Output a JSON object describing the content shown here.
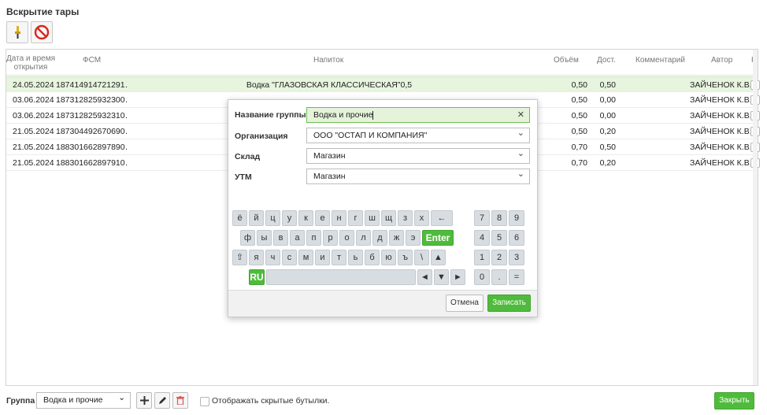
{
  "window": {
    "title": "Вскрытие тары"
  },
  "toolbar": {
    "open_icon": "bottle-opener-icon",
    "cancel_icon": "no-entry-icon"
  },
  "table": {
    "headers": {
      "date_line1": "Дата и время",
      "date_line2": "открытия",
      "fsm": "ФСМ",
      "drink": "Напиток",
      "volume": "Объём",
      "remaining": "Дост.",
      "comment": "Комментарий",
      "author": "Автор",
      "hidden": "Н"
    },
    "rows": [
      {
        "date": "24.05.2024",
        "fsm": "187414914721291…",
        "drink": "Водка \"ГЛАЗОВСКАЯ КЛАССИЧЕСКАЯ\"0,5",
        "volume": "0,50",
        "remaining": "0,50",
        "author": "ЗАЙЧЕНОК К.В.",
        "selected": true
      },
      {
        "date": "03.06.2024",
        "fsm": "187312825932300…",
        "drink": "",
        "volume": "0,50",
        "remaining": "0,00",
        "author": "ЗАЙЧЕНОК К.В.",
        "selected": false
      },
      {
        "date": "03.06.2024",
        "fsm": "187312825932310…",
        "drink": "",
        "volume": "0,50",
        "remaining": "0,00",
        "author": "ЗАЙЧЕНОК К.В.",
        "selected": false
      },
      {
        "date": "21.05.2024",
        "fsm": "187304492670690…",
        "drink": "",
        "volume": "0,50",
        "remaining": "0,20",
        "author": "ЗАЙЧЕНОК К.В.",
        "selected": false
      },
      {
        "date": "21.05.2024",
        "fsm": "188301662897890…",
        "drink": "",
        "volume": "0,70",
        "remaining": "0,50",
        "author": "ЗАЙЧЕНОК К.В.",
        "selected": false
      },
      {
        "date": "21.05.2024",
        "fsm": "188301662897910…",
        "drink": "",
        "volume": "0,70",
        "remaining": "0,20",
        "author": "ЗАЙЧЕНОК К.В.",
        "selected": false
      }
    ]
  },
  "modal": {
    "group_name_label": "Название группы",
    "group_name_value": "Водка и прочие",
    "org_label": "Организация",
    "org_value": "ООО \"ОСТАП И КОМПАНИЯ\"",
    "warehouse_label": "Склад",
    "warehouse_value": "Магазин",
    "utm_label": "УТМ",
    "utm_value": "Магазин",
    "clear_glyph": "✕",
    "chevron_glyph": "⌄",
    "cancel_label": "Отмена",
    "save_label": "Записать"
  },
  "keyboard": {
    "row1": [
      "ё",
      "й",
      "ц",
      "у",
      "к",
      "е",
      "н",
      "г",
      "ш",
      "щ",
      "з",
      "х",
      "←"
    ],
    "row2": [
      "ф",
      "ы",
      "в",
      "а",
      "п",
      "р",
      "о",
      "л",
      "д",
      "ж",
      "э",
      "Enter"
    ],
    "row3": [
      "⇧",
      "я",
      "ч",
      "с",
      "м",
      "и",
      "т",
      "ь",
      "б",
      "ю",
      "ъ",
      "\\",
      "▲"
    ],
    "row4": [
      "RU",
      "",
      "◄",
      "▼",
      "►"
    ],
    "numpad": [
      [
        "7",
        "8",
        "9"
      ],
      [
        "4",
        "5",
        "6"
      ],
      [
        "1",
        "2",
        "3"
      ],
      [
        "0",
        ".",
        "="
      ]
    ]
  },
  "bottom": {
    "group_label": "Группа",
    "group_value": "Водка и прочие",
    "show_hidden_label": "Отображать скрытые бутылки.",
    "close_label": "Закрыть"
  },
  "colors": {
    "accent_green": "#4fbb3c",
    "selected_row": "#e7f4de",
    "delete_red": "#e05a5a"
  }
}
